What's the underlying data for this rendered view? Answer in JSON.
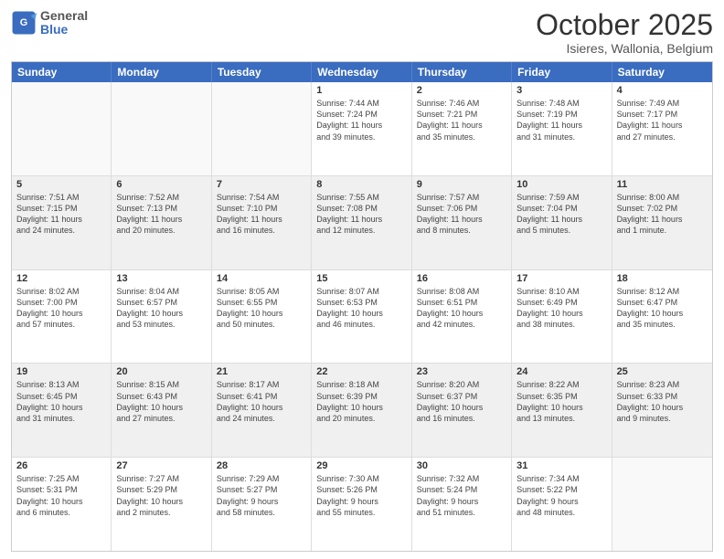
{
  "header": {
    "logo_general": "General",
    "logo_blue": "Blue",
    "month_title": "October 2025",
    "subtitle": "Isieres, Wallonia, Belgium"
  },
  "day_headers": [
    "Sunday",
    "Monday",
    "Tuesday",
    "Wednesday",
    "Thursday",
    "Friday",
    "Saturday"
  ],
  "weeks": [
    [
      {
        "num": "",
        "info": ""
      },
      {
        "num": "",
        "info": ""
      },
      {
        "num": "",
        "info": ""
      },
      {
        "num": "1",
        "info": "Sunrise: 7:44 AM\nSunset: 7:24 PM\nDaylight: 11 hours\nand 39 minutes."
      },
      {
        "num": "2",
        "info": "Sunrise: 7:46 AM\nSunset: 7:21 PM\nDaylight: 11 hours\nand 35 minutes."
      },
      {
        "num": "3",
        "info": "Sunrise: 7:48 AM\nSunset: 7:19 PM\nDaylight: 11 hours\nand 31 minutes."
      },
      {
        "num": "4",
        "info": "Sunrise: 7:49 AM\nSunset: 7:17 PM\nDaylight: 11 hours\nand 27 minutes."
      }
    ],
    [
      {
        "num": "5",
        "info": "Sunrise: 7:51 AM\nSunset: 7:15 PM\nDaylight: 11 hours\nand 24 minutes."
      },
      {
        "num": "6",
        "info": "Sunrise: 7:52 AM\nSunset: 7:13 PM\nDaylight: 11 hours\nand 20 minutes."
      },
      {
        "num": "7",
        "info": "Sunrise: 7:54 AM\nSunset: 7:10 PM\nDaylight: 11 hours\nand 16 minutes."
      },
      {
        "num": "8",
        "info": "Sunrise: 7:55 AM\nSunset: 7:08 PM\nDaylight: 11 hours\nand 12 minutes."
      },
      {
        "num": "9",
        "info": "Sunrise: 7:57 AM\nSunset: 7:06 PM\nDaylight: 11 hours\nand 8 minutes."
      },
      {
        "num": "10",
        "info": "Sunrise: 7:59 AM\nSunset: 7:04 PM\nDaylight: 11 hours\nand 5 minutes."
      },
      {
        "num": "11",
        "info": "Sunrise: 8:00 AM\nSunset: 7:02 PM\nDaylight: 11 hours\nand 1 minute."
      }
    ],
    [
      {
        "num": "12",
        "info": "Sunrise: 8:02 AM\nSunset: 7:00 PM\nDaylight: 10 hours\nand 57 minutes."
      },
      {
        "num": "13",
        "info": "Sunrise: 8:04 AM\nSunset: 6:57 PM\nDaylight: 10 hours\nand 53 minutes."
      },
      {
        "num": "14",
        "info": "Sunrise: 8:05 AM\nSunset: 6:55 PM\nDaylight: 10 hours\nand 50 minutes."
      },
      {
        "num": "15",
        "info": "Sunrise: 8:07 AM\nSunset: 6:53 PM\nDaylight: 10 hours\nand 46 minutes."
      },
      {
        "num": "16",
        "info": "Sunrise: 8:08 AM\nSunset: 6:51 PM\nDaylight: 10 hours\nand 42 minutes."
      },
      {
        "num": "17",
        "info": "Sunrise: 8:10 AM\nSunset: 6:49 PM\nDaylight: 10 hours\nand 38 minutes."
      },
      {
        "num": "18",
        "info": "Sunrise: 8:12 AM\nSunset: 6:47 PM\nDaylight: 10 hours\nand 35 minutes."
      }
    ],
    [
      {
        "num": "19",
        "info": "Sunrise: 8:13 AM\nSunset: 6:45 PM\nDaylight: 10 hours\nand 31 minutes."
      },
      {
        "num": "20",
        "info": "Sunrise: 8:15 AM\nSunset: 6:43 PM\nDaylight: 10 hours\nand 27 minutes."
      },
      {
        "num": "21",
        "info": "Sunrise: 8:17 AM\nSunset: 6:41 PM\nDaylight: 10 hours\nand 24 minutes."
      },
      {
        "num": "22",
        "info": "Sunrise: 8:18 AM\nSunset: 6:39 PM\nDaylight: 10 hours\nand 20 minutes."
      },
      {
        "num": "23",
        "info": "Sunrise: 8:20 AM\nSunset: 6:37 PM\nDaylight: 10 hours\nand 16 minutes."
      },
      {
        "num": "24",
        "info": "Sunrise: 8:22 AM\nSunset: 6:35 PM\nDaylight: 10 hours\nand 13 minutes."
      },
      {
        "num": "25",
        "info": "Sunrise: 8:23 AM\nSunset: 6:33 PM\nDaylight: 10 hours\nand 9 minutes."
      }
    ],
    [
      {
        "num": "26",
        "info": "Sunrise: 7:25 AM\nSunset: 5:31 PM\nDaylight: 10 hours\nand 6 minutes."
      },
      {
        "num": "27",
        "info": "Sunrise: 7:27 AM\nSunset: 5:29 PM\nDaylight: 10 hours\nand 2 minutes."
      },
      {
        "num": "28",
        "info": "Sunrise: 7:29 AM\nSunset: 5:27 PM\nDaylight: 9 hours\nand 58 minutes."
      },
      {
        "num": "29",
        "info": "Sunrise: 7:30 AM\nSunset: 5:26 PM\nDaylight: 9 hours\nand 55 minutes."
      },
      {
        "num": "30",
        "info": "Sunrise: 7:32 AM\nSunset: 5:24 PM\nDaylight: 9 hours\nand 51 minutes."
      },
      {
        "num": "31",
        "info": "Sunrise: 7:34 AM\nSunset: 5:22 PM\nDaylight: 9 hours\nand 48 minutes."
      },
      {
        "num": "",
        "info": ""
      }
    ]
  ]
}
